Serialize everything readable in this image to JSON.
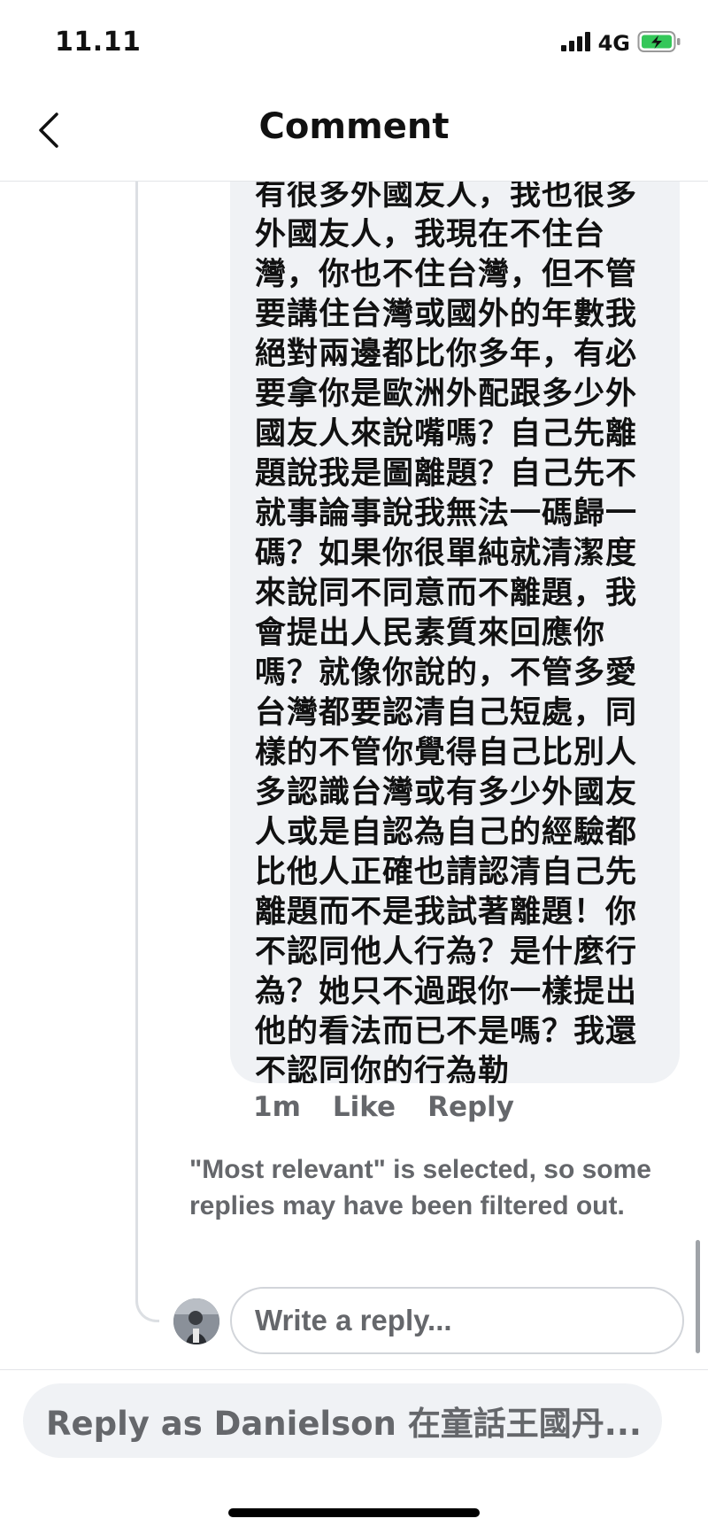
{
  "status_bar": {
    "time": "11.11",
    "network": "4G",
    "icons": [
      "signal-icon",
      "battery-charging-icon"
    ],
    "battery_color": "#34c759"
  },
  "header": {
    "title": "Comment",
    "back_icon": "chevron-left-icon"
  },
  "comment": {
    "lines": [
      "有很多外國友人，我也很多",
      "外國友人，我現在不住台",
      "灣，你也不住台灣，但不管",
      "要講住台灣或國外的年數我",
      "絕對兩邊都比你多年，有必",
      "要拿你是歐洲外配跟多少外",
      "國友人來說嘴嗎？自己先離",
      "題說我是圖離題？自己先不",
      "就事論事說我無法一碼歸一",
      "碼？如果你很單純就清潔度",
      "來說同不同意而不離題，我",
      "會提出人民素質來回應你",
      "嗎？就像你說的，不管多愛",
      "台灣都要認清自己短處，同",
      "樣的不管你覺得自己比別人",
      "多認識台灣或有多少外國友",
      "人或是自認為自己的經驗都",
      "比他人正確也請認清自己先",
      "離題而不是我試著離題！你",
      "不認同他人行為？是什麼行",
      "為？她只不過跟你一樣提出",
      "他的看法而已不是嗎？我還",
      "不認同你的行為勒"
    ],
    "timestamp": "1m",
    "like_label": "Like",
    "reply_label": "Reply"
  },
  "filter_notice": "\"Most relevant\" is selected, so some replies may have been filtered out.",
  "reply_box": {
    "placeholder": "Write a reply..."
  },
  "composer": {
    "placeholder": "Reply as Danielson 在童話王國丹..."
  },
  "colors": {
    "bubble": "#f0f2f5",
    "secondary_text": "#65676b",
    "thread_line": "#dcdfe3"
  }
}
